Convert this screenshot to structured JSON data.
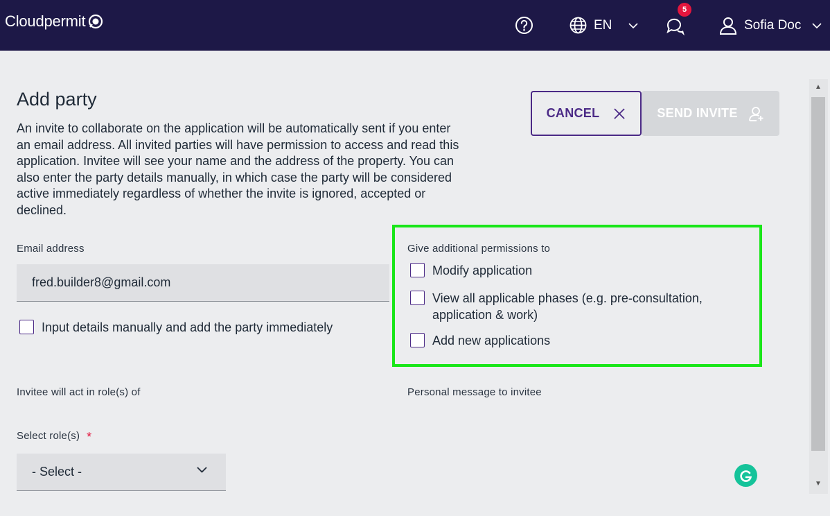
{
  "header": {
    "logo_text": "Cloudpermit",
    "language": "EN",
    "notification_count": "5",
    "user_name": "Sofia Doc",
    "colors": {
      "bar": "#1d1847",
      "badge": "#e3163e"
    },
    "icons": [
      "help-icon",
      "globe-icon",
      "chevron-down-icon",
      "chat-icon",
      "user-icon"
    ]
  },
  "page": {
    "title": "Add party",
    "description": "An invite to collaborate on the application will be automatically sent if you enter an email address. All invited parties will have permission to access and read this application. Invitee will see your name and the address of the property. You can also enter the party details manually, in which case the party will be considered active immediately regardless of whether the invite is ignored, accepted or declined."
  },
  "actions": {
    "cancel_label": "CANCEL",
    "send_label": "SEND INVITE"
  },
  "email": {
    "label": "Email address",
    "value": "fred.builder8@gmail.com"
  },
  "manual": {
    "label": "Input details manually and add the party immediately",
    "checked": false
  },
  "permissions": {
    "label": "Give additional permissions to",
    "options": [
      {
        "label": "Modify application",
        "checked": false
      },
      {
        "label": "View all applicable phases (e.g. pre-consultation, application & work)",
        "checked": false
      },
      {
        "label": "Add new applications",
        "checked": false
      }
    ],
    "highlight_color": "#19e619"
  },
  "roles": {
    "section_label": "Invitee will act in role(s) of",
    "select_label": "Select role(s)",
    "required_mark": "*",
    "selected": "- Select -"
  },
  "message": {
    "label": "Personal message to invitee"
  },
  "accent_color": "#4b2a86"
}
